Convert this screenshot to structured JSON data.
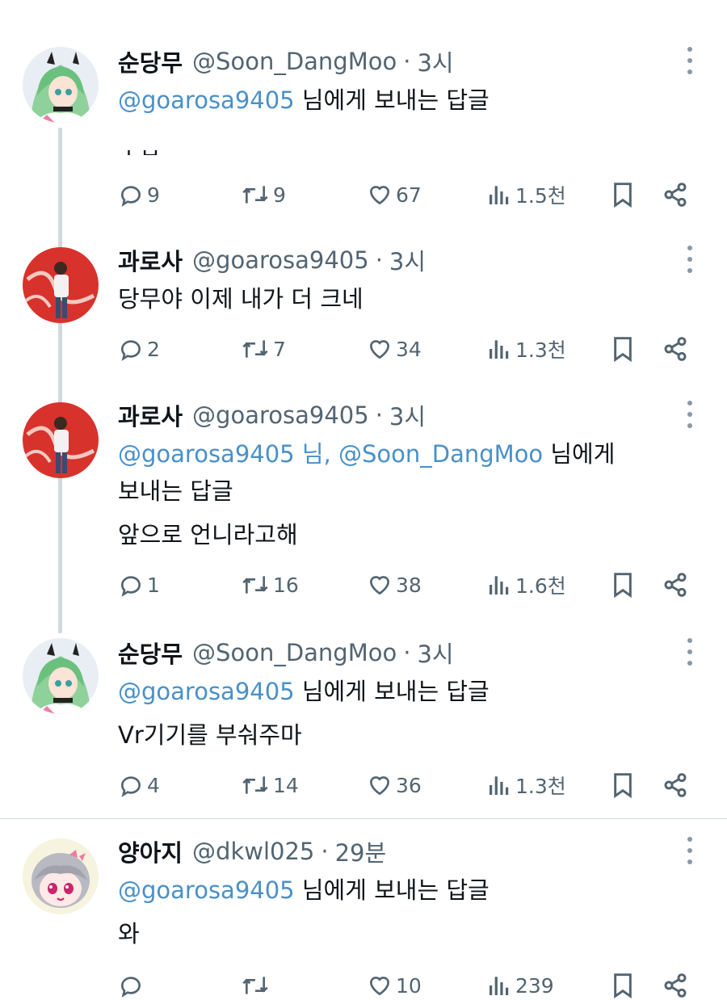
{
  "tweets": [
    {
      "name": "순당무",
      "handle": "@Soon_DangMoo",
      "sep": "·",
      "time": "3시",
      "reply_mention": "@goarosa9405",
      "reply_suffix": " 님에게 보내는 답글",
      "body": "ㅅㅂ",
      "stats": {
        "replies": "9",
        "retweets": "9",
        "likes": "67",
        "views": "1.5천"
      },
      "avatar": "green-hair-character"
    },
    {
      "name": "과로사",
      "handle": "@goarosa9405",
      "sep": "·",
      "time": "3시",
      "body": "당무야 이제 내가 더 크네",
      "stats": {
        "replies": "2",
        "retweets": "7",
        "likes": "34",
        "views": "1.3천"
      },
      "avatar": "person-red-background"
    },
    {
      "name": "과로사",
      "handle": "@goarosa9405",
      "sep": "·",
      "time": "3시",
      "reply_mention_1": "@goarosa9405",
      "reply_mid": " 님, ",
      "reply_mention_2": "@Soon_DangMoo",
      "reply_suffix_1": " 님에게",
      "reply_suffix_2": "보내는 답글",
      "body": "앞으로 언니라고해",
      "stats": {
        "replies": "1",
        "retweets": "16",
        "likes": "38",
        "views": "1.6천"
      },
      "avatar": "person-red-background"
    },
    {
      "name": "순당무",
      "handle": "@Soon_DangMoo",
      "sep": "·",
      "time": "3시",
      "reply_mention": "@goarosa9405",
      "reply_suffix": " 님에게 보내는 답글",
      "body": "Vr기기를 부숴주마",
      "stats": {
        "replies": "4",
        "retweets": "14",
        "likes": "36",
        "views": "1.3천"
      },
      "avatar": "green-hair-character"
    },
    {
      "name": "양아지",
      "handle": "@dkwl025",
      "sep": "·",
      "time": "29분",
      "reply_mention": "@goarosa9405",
      "reply_suffix": " 님에게 보내는 답글",
      "body": "와",
      "stats": {
        "replies": "",
        "retweets": "",
        "likes": "10",
        "views": "239"
      },
      "avatar": "silver-hair-chibi"
    }
  ],
  "colors": {
    "mention": "#4a90c8",
    "secondary": "#536471",
    "thread_line": "#cfd9de"
  }
}
